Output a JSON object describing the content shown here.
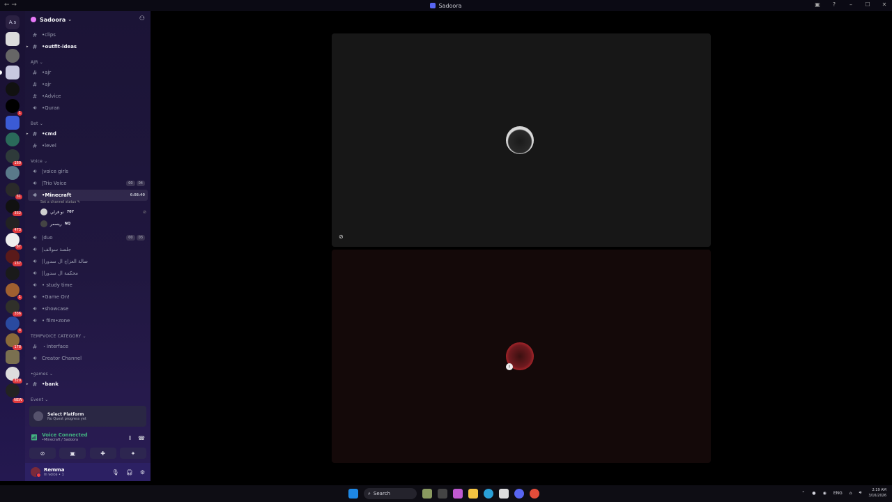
{
  "window": {
    "title": "Sadoora"
  },
  "server": {
    "name": "Sadoora"
  },
  "guild_top_label": "A.s",
  "guild_badges": [
    "",
    "",
    "",
    "",
    "1",
    "",
    "",
    "160",
    "31",
    "332",
    "473",
    "87",
    "137",
    "",
    "1",
    "336",
    "4",
    "178",
    "",
    "320",
    "NEW"
  ],
  "channels": {
    "clips": "•clips",
    "outfit": "•outfit-ideas",
    "cat_ajr": "AJR",
    "ajr1": "•ajr",
    "ajr2": "•ajr",
    "advice": "•Advice",
    "quran": "•Quran",
    "cat_bot": "Bot",
    "cmd": "•cmd",
    "level": "•level",
    "cat_voice": "Voice",
    "voice_girls": "|voice girls",
    "trio": "|Trio Voice",
    "trio_counts": [
      "00",
      "04"
    ],
    "minecraft": "•Minecraft",
    "minecraft_timer": "6:08:40",
    "minecraft_status": "Set a channel status ✎",
    "duo": "|duo",
    "duo_counts": [
      "00",
      "03"
    ],
    "ar1": "|جلسة سوالف",
    "ar2": "|صالة العزاج ال سدورا",
    "ar3": "|محكمة ال سدورا",
    "study": "• study time",
    "gameon": "•Game On!",
    "showcase": "•showcase",
    "film": "• film•zone",
    "cat_temp": "TEMPVOICE CATEGORY",
    "interface": "・interface",
    "creator": "Creator Channel",
    "cat_games": "•games",
    "bank": "•bank",
    "cat_event": "Event"
  },
  "voice_users": [
    {
      "name": "نو فرلي",
      "tag": "707"
    },
    {
      "name": "ريسمر",
      "tag": "NQ"
    }
  ],
  "quest": {
    "title": "Select Platform",
    "subtitle": "No Quest progress yet"
  },
  "voice_connected": {
    "title": "Voice Connected",
    "subtitle": "•Minecraft / Sadoora"
  },
  "user": {
    "name": "Remma",
    "status": "In voice • 1"
  },
  "taskbar": {
    "search": "Search",
    "lang": "ENG",
    "time": "2:19 AM",
    "date": "3/16/2026"
  }
}
